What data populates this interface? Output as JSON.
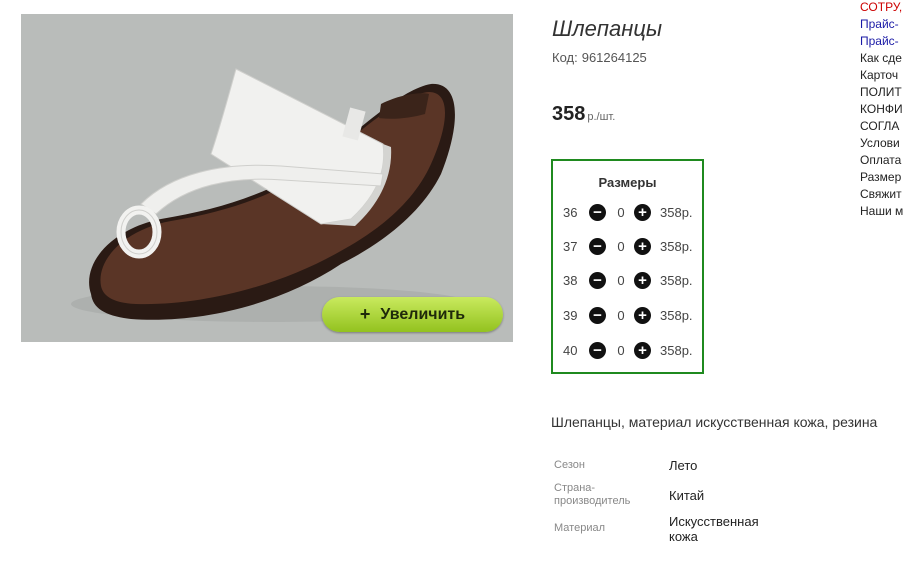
{
  "product": {
    "title": "Шлепанцы",
    "code_label": "Код:",
    "code": "961264125",
    "price": "358",
    "price_unit": "р./шт.",
    "zoom_label": "Увеличить",
    "zoom_icon": "+"
  },
  "sizes": {
    "title": "Размеры",
    "rows": [
      {
        "size": "36",
        "qty": "0",
        "price": "358р."
      },
      {
        "size": "37",
        "qty": "0",
        "price": "358р."
      },
      {
        "size": "38",
        "qty": "0",
        "price": "358р."
      },
      {
        "size": "39",
        "qty": "0",
        "price": "358р."
      },
      {
        "size": "40",
        "qty": "0",
        "price": "358р."
      }
    ],
    "minus_icon": "−",
    "plus_icon": "+"
  },
  "description": "Шлепанцы, материал искусственная кожа, резина",
  "attributes": [
    {
      "label": "Сезон",
      "value": "Лето"
    },
    {
      "label": "Страна-производитель",
      "value": "Китай"
    },
    {
      "label": "Материал",
      "value": "Искусственная кожа"
    }
  ],
  "side_links": [
    {
      "text": "СОТРУ,",
      "color": "#cc0000"
    },
    {
      "text": "Прайс-",
      "color": "#1a1aa6"
    },
    {
      "text": "Прайс-",
      "color": "#1a1aa6"
    },
    {
      "text": "Как сде",
      "color": "#222222"
    },
    {
      "text": "Карточ",
      "color": "#222222"
    },
    {
      "text": "ПОЛИТ",
      "color": "#222222"
    },
    {
      "text": "КОНФИ",
      "color": "#222222"
    },
    {
      "text": "СОГЛА",
      "color": "#222222"
    },
    {
      "text": "Услови",
      "color": "#222222"
    },
    {
      "text": "Оплата",
      "color": "#222222"
    },
    {
      "text": "Размер",
      "color": "#222222"
    },
    {
      "text": "Свяжит",
      "color": "#222222"
    },
    {
      "text": "Наши м",
      "color": "#222222"
    }
  ],
  "colors": {
    "sizes_border": "#1f8a1f",
    "zoom_button": "#a6d13a"
  }
}
